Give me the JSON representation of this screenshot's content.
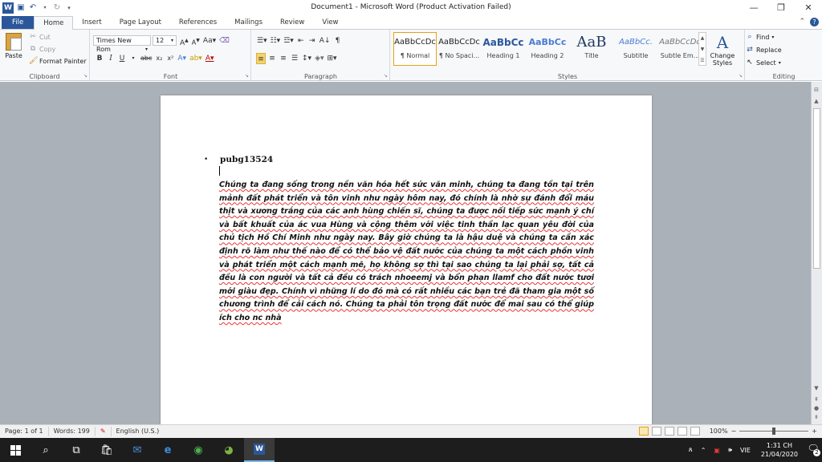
{
  "window": {
    "title": "Document1 - Microsoft Word (Product Activation Failed)",
    "logo_letter": "W",
    "minimize": "—",
    "maximize": "❐",
    "close": "✕"
  },
  "tabs": [
    {
      "label": "File"
    },
    {
      "label": "Home"
    },
    {
      "label": "Insert"
    },
    {
      "label": "Page Layout"
    },
    {
      "label": "References"
    },
    {
      "label": "Mailings"
    },
    {
      "label": "Review"
    },
    {
      "label": "View"
    }
  ],
  "ribbon": {
    "clipboard": {
      "label": "Clipboard",
      "paste": "Paste",
      "cut": "Cut",
      "copy": "Copy",
      "format_painter": "Format Painter"
    },
    "font": {
      "label": "Font",
      "font_name": "Times New Rom",
      "font_size": "12"
    },
    "paragraph": {
      "label": "Paragraph"
    },
    "styles": {
      "label": "Styles",
      "items": [
        {
          "preview": "AaBbCcDc",
          "name": "¶ Normal"
        },
        {
          "preview": "AaBbCcDc",
          "name": "¶ No Spaci..."
        },
        {
          "preview": "AaBbCc",
          "name": "Heading 1"
        },
        {
          "preview": "AaBbCc",
          "name": "Heading 2"
        },
        {
          "preview": "AaB",
          "name": "Title"
        },
        {
          "preview": "AaBbCc.",
          "name": "Subtitle"
        },
        {
          "preview": "AaBbCcDc",
          "name": "Subtle Em..."
        }
      ],
      "change_styles_1": "Change",
      "change_styles_2": "Styles"
    },
    "editing": {
      "label": "Editing",
      "find": "Find",
      "replace": "Replace",
      "select": "Select"
    }
  },
  "document": {
    "heading": "pubg13524",
    "body": "Chúng ta đang sống trong nền văn hóa hết sức văn minh, chúng ta đang tồn tại trên mảnh đất phát triển và tôn vinh như ngày hôm nay, đó chính là nhờ sự đánh đổi máu thịt và xương trắng của các anh hùng chiến sĩ, chúng ta được nối tiếp sức mạnh ý chí và bất khuất của ác vua Hùng và cộng thêm với việc tinh thần lạc quan yêu đời của chủ tịch Hồ Chí Minh như ngày nay. Bây giờ chúng ta là hậu duệ và chúng ta cần xác định rõ làm như thế nào để có thể bảo vệ đất nước của chúng ta một cách phồn vinh và phát triển một cách mạnh mẽ, họ không sợ thì tại sao chúng ta lại phải sợ, tất cả đều là con người và tất cả đều có trách nhoeemj và bổn phạn llamf cho đất nước tươi mới giàu đẹp. Chính vì những lí do đó mà có rất nhiều các bạn trẻ đã tham gia một số chương trình để cải cách nó. Chúng ta phải tôn trọng đất nước để mai sau có thể giúp ích cho nc nhà"
  },
  "status": {
    "page": "Page: 1 of 1",
    "words": "Words: 199",
    "language": "English (U.S.)",
    "zoom": "100%",
    "zoom_minus": "−",
    "zoom_plus": "+"
  },
  "taskbar": {
    "lang": "VIE",
    "time": "1:31 CH",
    "date": "21/04/2020",
    "notifications": "2"
  }
}
